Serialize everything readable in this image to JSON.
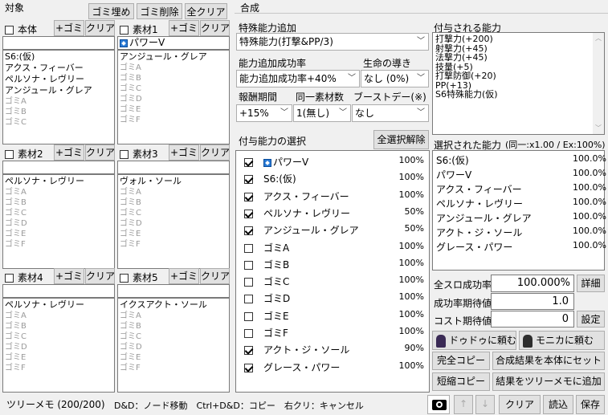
{
  "left": {
    "title": "対象",
    "top_buttons": [
      "ゴミ埋め",
      "ゴミ削除",
      "全クリア"
    ],
    "add_label": "+ゴミ",
    "clear_label": "クリア",
    "slots": [
      {
        "name": "本体",
        "header": "",
        "main": "S6:(仮)\nアクス・フィーバー\nペルソナ・レヴリー\nアンジュール・グレア",
        "gray": "ゴミA\nゴミB\nゴミC"
      },
      {
        "name": "素材1",
        "header": "パワーV",
        "main": "アンジュール・グレア",
        "gray": "ゴミA\nゴミB\nゴミC\nゴミD\nゴミE\nゴミF"
      },
      {
        "name": "素材2",
        "header": "",
        "main": "ペルソナ・レヴリー",
        "gray": "ゴミA\nゴミB\nゴミC\nゴミD\nゴミE\nゴミF"
      },
      {
        "name": "素材3",
        "header": "",
        "main": "ヴォル・ソール",
        "gray": "ゴミA\nゴミB\nゴミC\nゴミD\nゴミE\nゴミF"
      },
      {
        "name": "素材4",
        "header": "",
        "main": "ペルソナ・レヴリー",
        "gray": "ゴミA\nゴミB\nゴミC\nゴミD\nゴミE\nゴミF"
      },
      {
        "name": "素材5",
        "header": "",
        "main": "イクスアクト・ソール",
        "gray": "ゴミA\nゴミB\nゴミC\nゴミD\nゴミE\nゴミF"
      }
    ]
  },
  "mid": {
    "tab": "合成",
    "special_label": "特殊能力追加",
    "special_value": "特殊能力(打撃&PP/3)",
    "rate_label": "能力追加成功率",
    "rate_value": "能力追加成功率+40%",
    "guide_label": "生命の導き",
    "guide_value": "なし (0%)",
    "reward_label": "報酬期間",
    "reward_value": "+15%",
    "same_label": "同一素材数",
    "same_value": "1(無し)",
    "boost_label": "ブーストデー(※)",
    "boost_value": "なし",
    "select_label": "付与能力の選択",
    "deselect_label": "全選択解除",
    "abilities": [
      {
        "name": "パワーV",
        "pct": "100%",
        "checked": true,
        "icon": true
      },
      {
        "name": "S6:(仮)",
        "pct": "100%",
        "checked": true
      },
      {
        "name": "アクス・フィーバー",
        "pct": "100%",
        "checked": true
      },
      {
        "name": "ペルソナ・レヴリー",
        "pct": "50%",
        "checked": true
      },
      {
        "name": "アンジュール・グレア",
        "pct": "50%",
        "checked": true
      },
      {
        "name": "ゴミA",
        "pct": "100%",
        "checked": false
      },
      {
        "name": "ゴミB",
        "pct": "100%",
        "checked": false
      },
      {
        "name": "ゴミC",
        "pct": "100%",
        "checked": false
      },
      {
        "name": "ゴミD",
        "pct": "100%",
        "checked": false
      },
      {
        "name": "ゴミE",
        "pct": "100%",
        "checked": false
      },
      {
        "name": "ゴミF",
        "pct": "100%",
        "checked": false
      },
      {
        "name": "アクト・ジ・ソール",
        "pct": "90%",
        "checked": true
      },
      {
        "name": "グレース・パワー",
        "pct": "100%",
        "checked": true
      }
    ]
  },
  "right": {
    "granted_label": "付与される能力",
    "granted_text": "打撃力(+200)\n射撃力(+45)\n法撃力(+45)\n技量(+5)\n打撃防御(+20)\nPP(+13)\nS6特殊能力(仮)",
    "selected_label": "選択された能力",
    "selected_info": "(同一:x1.00 / Ex:100%)",
    "selected": [
      {
        "name": "S6:(仮)",
        "pct": "100.0%"
      },
      {
        "name": "パワーV",
        "pct": "100.0%"
      },
      {
        "name": "アクス・フィーバー",
        "pct": "100.0%"
      },
      {
        "name": "ペルソナ・レヴリー",
        "pct": "100.0%"
      },
      {
        "name": "アンジュール・グレア",
        "pct": "100.0%"
      },
      {
        "name": "アクト・ジ・ソール",
        "pct": "100.0%"
      },
      {
        "name": "グレース・パワー",
        "pct": "100.0%"
      }
    ],
    "all_slot_label": "全スロ成功率",
    "all_slot_value": "100.000%",
    "detail_label": "詳細",
    "expect_label": "成功率期待値",
    "expect_value": "1.0",
    "cost_label": "コスト期待値",
    "cost_value": "0",
    "setting_label": "設定",
    "ask1": "ドゥドゥに頼む",
    "ask2": "モニカに頼む",
    "full_copy": "完全コピー",
    "set_result": "合成結果を本体にセット",
    "short_copy": "短縮コピー",
    "add_tree": "結果をツリーメモに追加"
  },
  "bottom": {
    "memo": "ツリーメモ (200/200)",
    "hint": "D&D：ノード移動　Ctrl+D&D：コピー　右クリ：キャンセル",
    "up": "↑",
    "down": "↓",
    "clear": "クリア",
    "load": "読込",
    "save": "保存"
  }
}
